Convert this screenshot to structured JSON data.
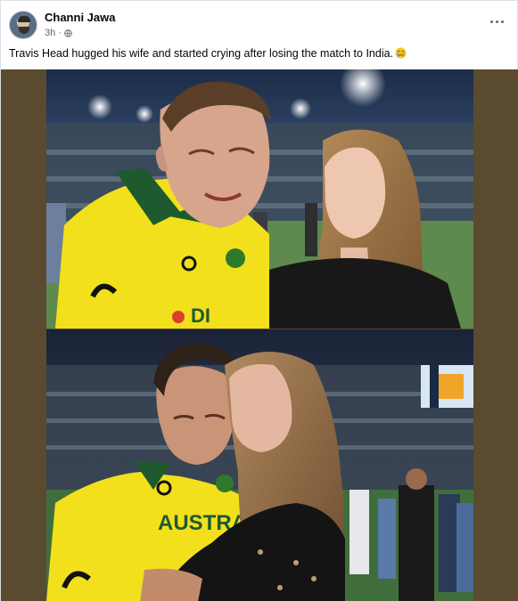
{
  "post": {
    "author": "Channi Jawa",
    "time": "3h",
    "caption": "Travis Head hugged his wife and started crying after losing the match to India.",
    "more_icon": "more-options-icon",
    "audience_icon": "globe-icon",
    "caption_emoji": "crying-face-emoji"
  },
  "photos": [
    {
      "jersey_text": "DI"
    },
    {
      "jersey_text": "AUSTRAL"
    }
  ],
  "colors": {
    "jersey_yellow": "#f2e01c",
    "jersey_green": "#1f5a2e",
    "media_bg": "#5a4a2f"
  }
}
